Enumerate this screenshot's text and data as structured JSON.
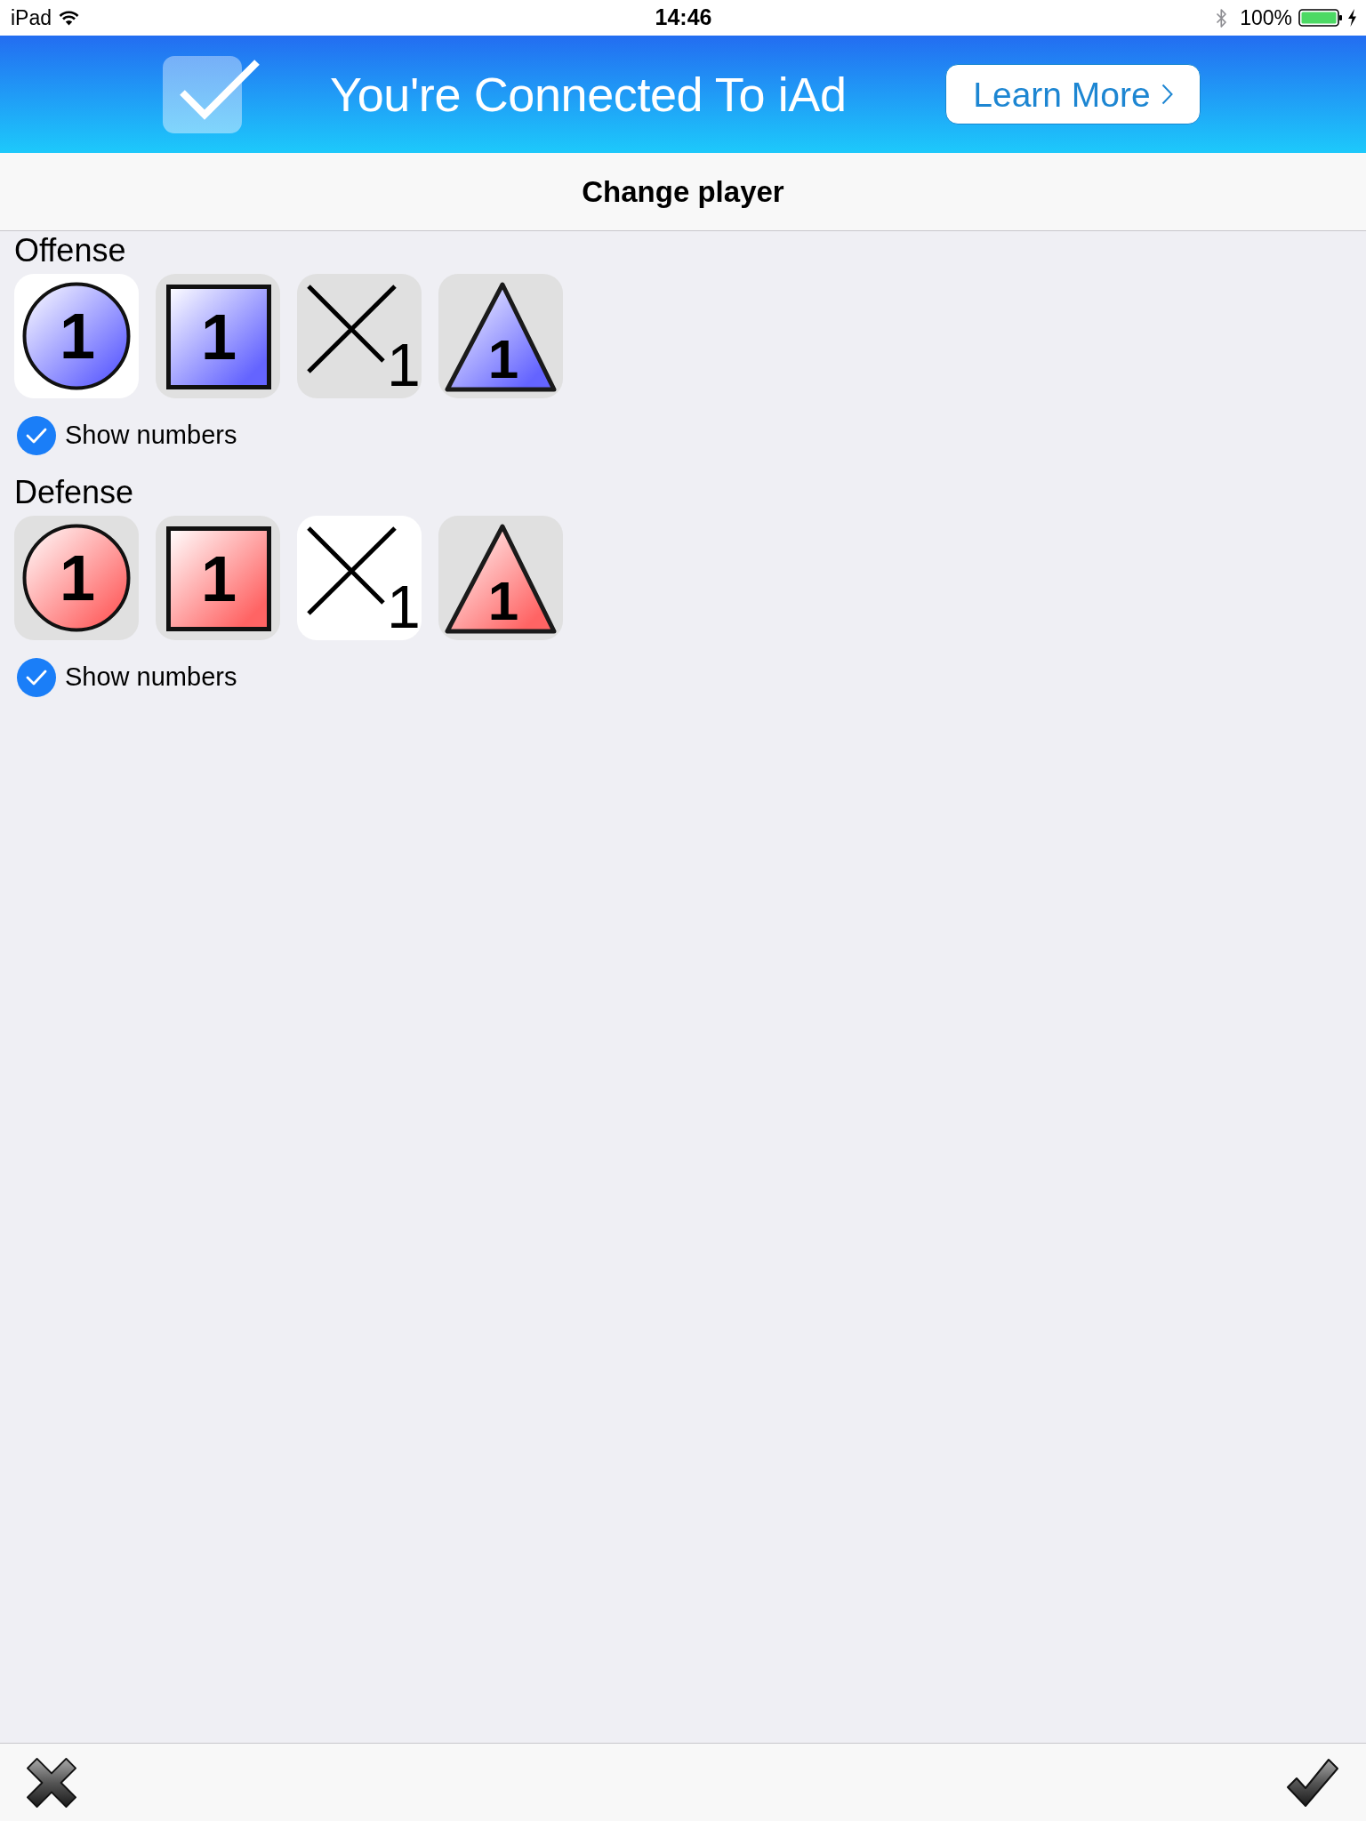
{
  "status_bar": {
    "carrier": "iPad",
    "time": "14:46",
    "battery": "100%",
    "charging": true
  },
  "ad_banner": {
    "title": "You're Connected To iAd",
    "button": "Learn More"
  },
  "nav_bar": {
    "title": "Change player"
  },
  "sections": [
    {
      "title": "Offense",
      "color": "#6464ff",
      "symbols": [
        {
          "kind": "circle",
          "label": "1",
          "selected": true
        },
        {
          "kind": "square",
          "label": "1",
          "selected": false
        },
        {
          "kind": "cross",
          "label": "1",
          "selected": false
        },
        {
          "kind": "triangle",
          "label": "1",
          "selected": false
        }
      ],
      "show_numbers": {
        "label": "Show numbers",
        "checked": true
      }
    },
    {
      "title": "Defense",
      "color": "#ff6464",
      "symbols": [
        {
          "kind": "circle",
          "label": "1",
          "selected": false
        },
        {
          "kind": "square",
          "label": "1",
          "selected": false
        },
        {
          "kind": "cross",
          "label": "1",
          "selected": true
        },
        {
          "kind": "triangle",
          "label": "1",
          "selected": false
        }
      ],
      "show_numbers": {
        "label": "Show numbers",
        "checked": true
      }
    }
  ]
}
